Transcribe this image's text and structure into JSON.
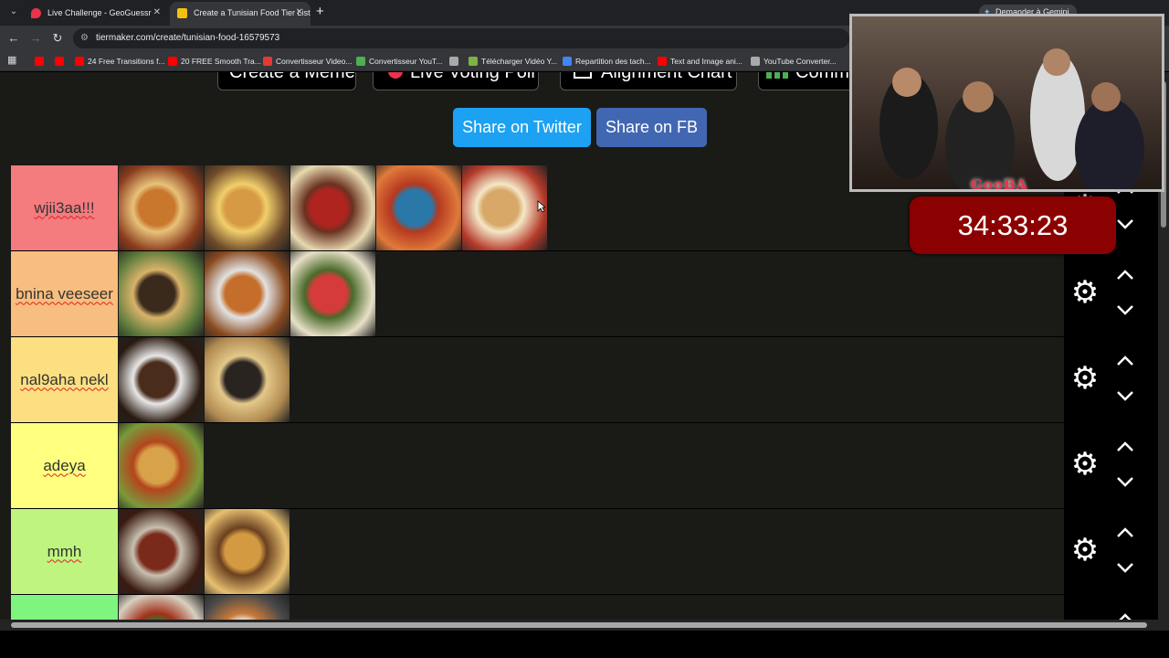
{
  "browser": {
    "tabs": [
      {
        "title": "Live Challenge - GeoGuessr",
        "favicon_color": "#e8334a"
      },
      {
        "title": "Create a Tunisian Food Tier List",
        "favicon_color": "#f4c20d"
      }
    ],
    "gemini_label": "Demander à Gemini",
    "url": "tiermaker.com/create/tunisian-food-16579573",
    "bookmarks": [
      {
        "label": "",
        "icon_color": "#ff0000"
      },
      {
        "label": "",
        "icon_color": "#ff0000"
      },
      {
        "label": "24 Free Transitions f...",
        "icon_color": "#ff0000"
      },
      {
        "label": "20 FREE Smooth Tra...",
        "icon_color": "#ff0000"
      },
      {
        "label": "Convertisseur Video...",
        "icon_color": "#e53935"
      },
      {
        "label": "Convertisseur YouT...",
        "icon_color": "#4caf50"
      },
      {
        "label": "",
        "icon_color": "#aaaaaa"
      },
      {
        "label": "Télécharger Vidéo Y...",
        "icon_color": "#7cb342"
      },
      {
        "label": "Repartition des tach...",
        "icon_color": "#4285f4"
      },
      {
        "label": "Text and Image ani...",
        "icon_color": "#ff0000"
      },
      {
        "label": "YouTube Converter...",
        "icon_color": "#aaaaaa"
      }
    ]
  },
  "page": {
    "top_buttons": [
      "Create a Meme",
      "Live Voting Poll",
      "Alignment Chart",
      "Comm"
    ],
    "share_twitter": "Share on Twitter",
    "share_fb": "Share on FB",
    "tiers": [
      {
        "label": "wjii3aa!!!",
        "color": "#f47b7e",
        "items": [
          "pizza",
          "grilled sandwiches with fries",
          "ojja stew bowl",
          "spaghetti with sauce",
          "crepe wrap with fries"
        ]
      },
      {
        "label": "bnina veeseer",
        "color": "#f8be7f",
        "items": [
          "pan pasta",
          "chorba soup",
          "grilled meat with vegetables"
        ]
      },
      {
        "label": "nal9aha nekl",
        "color": "#fbdf80",
        "items": [
          "meat kebabs",
          "mlawi flatbread"
        ]
      },
      {
        "label": "adeya",
        "color": "#ffff7f",
        "items": [
          "couscous"
        ]
      },
      {
        "label": "mmh",
        "color": "#bff57f",
        "items": [
          "meat stew",
          "couscous with meat"
        ]
      },
      {
        "label": "",
        "color": "#7ff57f",
        "items": [
          "stuffed vegetables",
          "soup bowl"
        ]
      }
    ]
  },
  "overlay": {
    "brand": "GooBA",
    "timer": "34:33:23"
  }
}
